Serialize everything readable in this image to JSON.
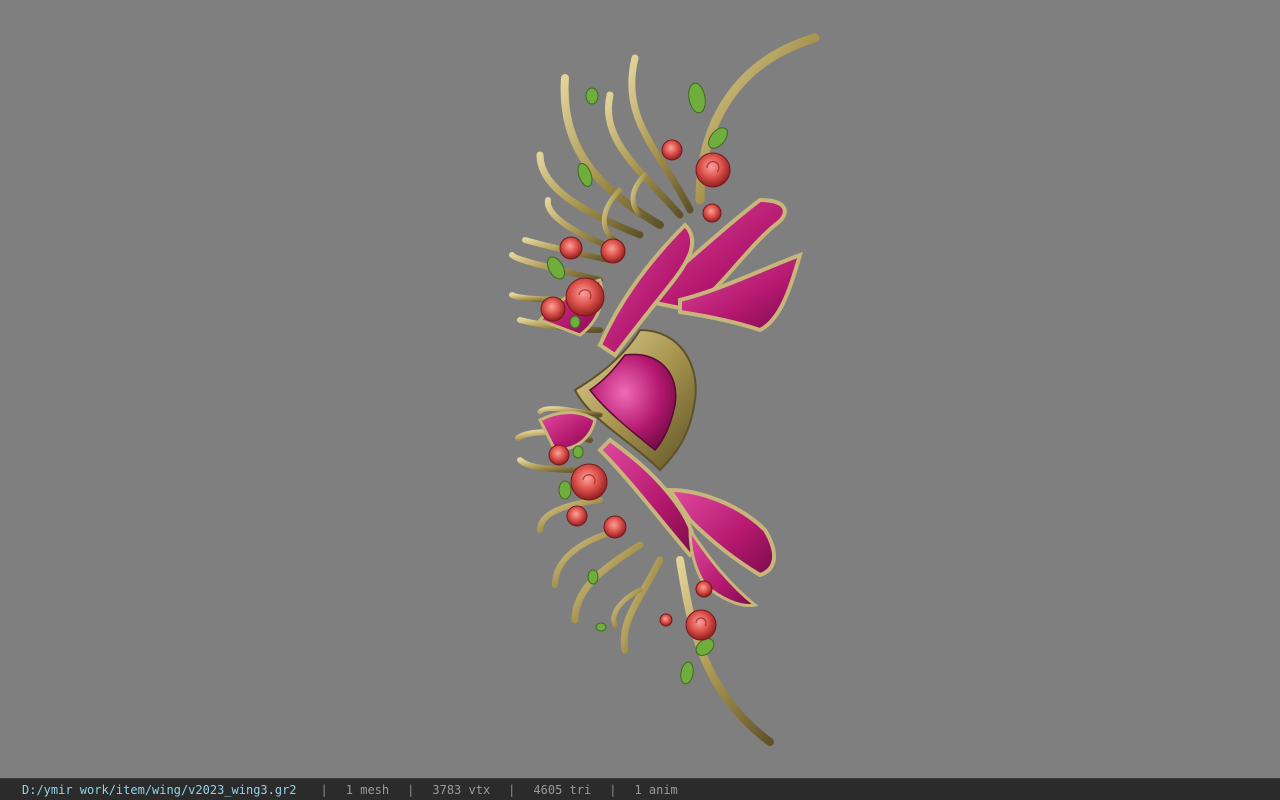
{
  "viewport": {
    "background": "#7f7f7f",
    "model_name": "wing",
    "colors": {
      "gold": "#b8a76a",
      "gold_dark": "#6f6236",
      "magenta": "#b4186f",
      "magenta_light": "#e04a9f",
      "rose": "#e0554f",
      "leaf": "#6fae3c"
    }
  },
  "statusbar": {
    "file_path": "D:/ymir work/item/wing/v2023_wing3.gr2",
    "separator": "|",
    "mesh_count": "1 mesh",
    "vertex_count": "3783 vtx",
    "triangle_count": "4605 tri",
    "anim_count": "1 anim"
  }
}
